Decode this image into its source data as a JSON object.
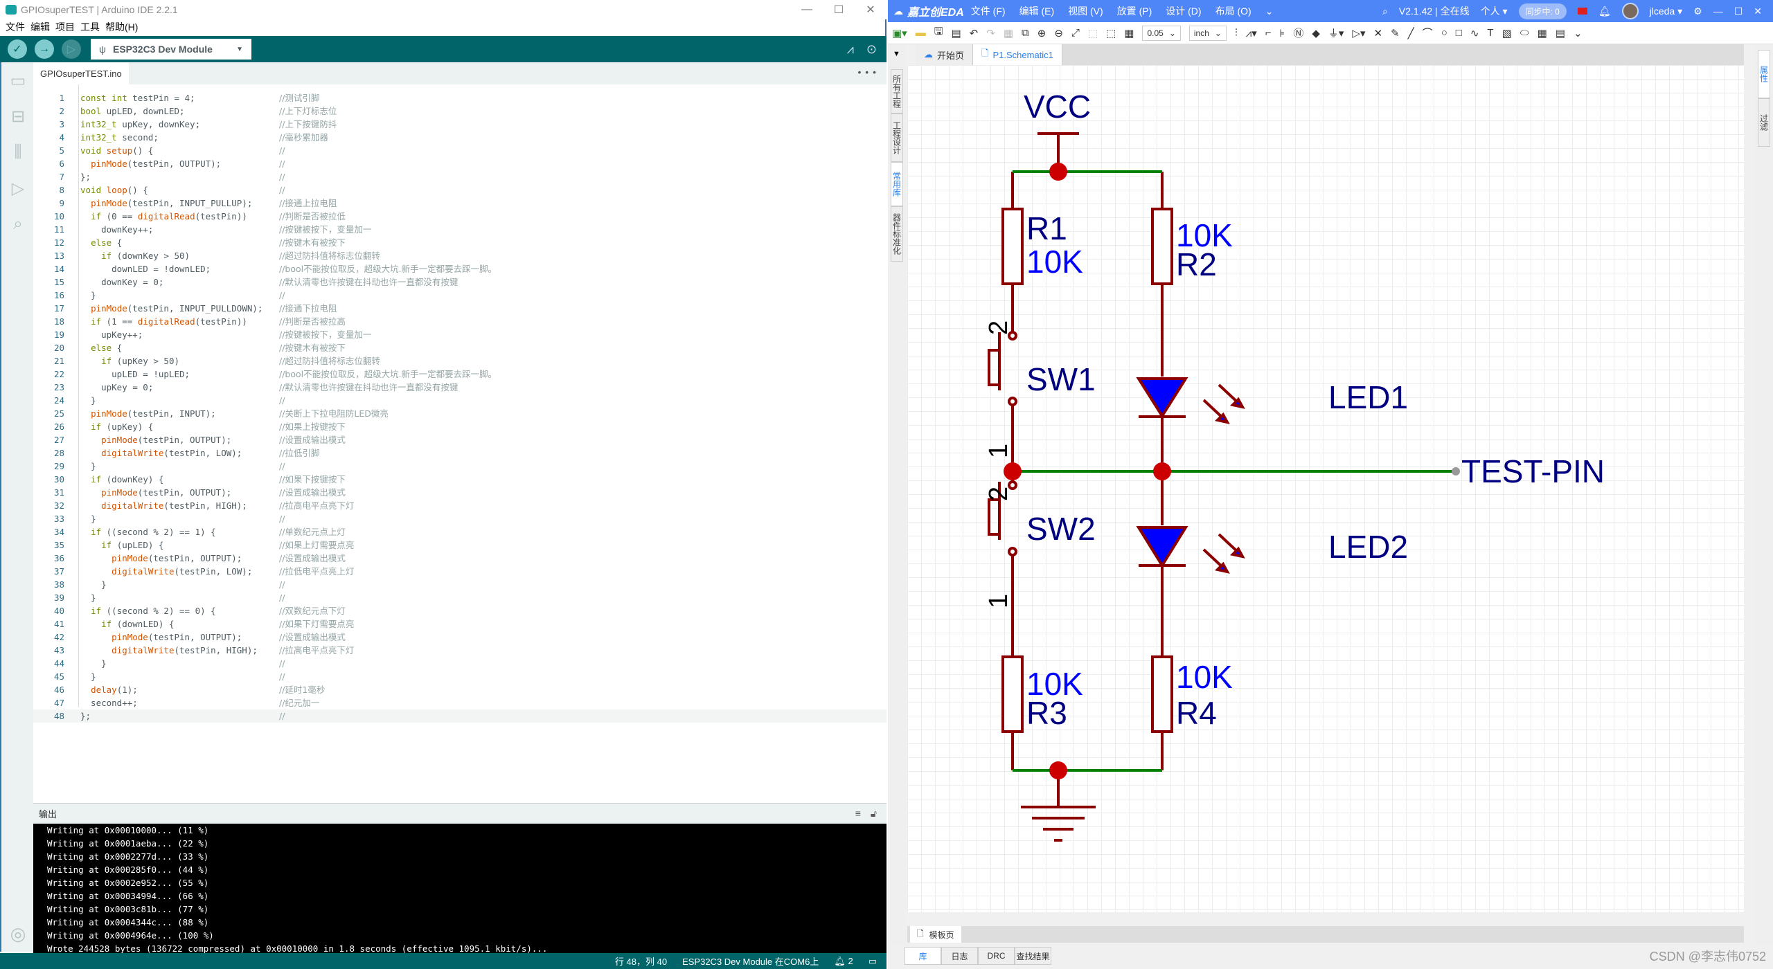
{
  "arduino": {
    "title": "GPIOsuperTEST | Arduino IDE 2.2.1",
    "menu": [
      "文件",
      "编辑",
      "项目",
      "工具",
      "帮助(H)"
    ],
    "board": "ESP32C3 Dev Module",
    "file_tab": "GPIOsuperTEST.ino",
    "code": [
      {
        "n": "1",
        "code": "const int testPin = 4;",
        "cmt": "//测试引脚"
      },
      {
        "n": "2",
        "code": "bool upLED, downLED;",
        "cmt": "//上下灯标志位"
      },
      {
        "n": "3",
        "code": "int32_t upKey, downKey;",
        "cmt": "//上下按键防抖"
      },
      {
        "n": "4",
        "code": "int32_t second;",
        "cmt": "//毫秒累加器"
      },
      {
        "n": "5",
        "code": "void setup() {",
        "cmt": "//"
      },
      {
        "n": "6",
        "code": "  pinMode(testPin, OUTPUT);",
        "cmt": "//"
      },
      {
        "n": "7",
        "code": "};",
        "cmt": "//"
      },
      {
        "n": "8",
        "code": "void loop() {",
        "cmt": "//"
      },
      {
        "n": "9",
        "code": "  pinMode(testPin, INPUT_PULLUP);",
        "cmt": "//接通上拉电阻"
      },
      {
        "n": "10",
        "code": "  if (0 == digitalRead(testPin))",
        "cmt": "//判断是否被拉低"
      },
      {
        "n": "11",
        "code": "    downKey++;",
        "cmt": "//按键被按下，变量加一"
      },
      {
        "n": "12",
        "code": "  else {",
        "cmt": "//按键木有被按下"
      },
      {
        "n": "13",
        "code": "    if (downKey > 50)",
        "cmt": "//超过防抖值将标志位翻转"
      },
      {
        "n": "14",
        "code": "      downLED = !downLED;",
        "cmt": "//bool不能按位取反，超级大坑.新手一定都要去踩一脚。"
      },
      {
        "n": "15",
        "code": "    downKey = 0;",
        "cmt": "//默认清零也许按键在抖动也许一直都没有按键"
      },
      {
        "n": "16",
        "code": "  }",
        "cmt": "//"
      },
      {
        "n": "17",
        "code": "  pinMode(testPin, INPUT_PULLDOWN);",
        "cmt": "//接通下拉电阻"
      },
      {
        "n": "18",
        "code": "  if (1 == digitalRead(testPin))",
        "cmt": "//判断是否被拉高"
      },
      {
        "n": "19",
        "code": "    upKey++;",
        "cmt": "//按键被按下，变量加一"
      },
      {
        "n": "20",
        "code": "  else {",
        "cmt": "//按键木有被按下"
      },
      {
        "n": "21",
        "code": "    if (upKey > 50)",
        "cmt": "//超过防抖值将标志位翻转"
      },
      {
        "n": "22",
        "code": "      upLED = !upLED;",
        "cmt": "//bool不能按位取反，超级大坑.新手一定都要去踩一脚。"
      },
      {
        "n": "23",
        "code": "    upKey = 0;",
        "cmt": "//默认清零也许按键在抖动也许一直都没有按键"
      },
      {
        "n": "24",
        "code": "  }",
        "cmt": "//"
      },
      {
        "n": "25",
        "code": "  pinMode(testPin, INPUT);",
        "cmt": "//关断上下拉电阻防LED微亮"
      },
      {
        "n": "26",
        "code": "  if (upKey) {",
        "cmt": "//如果上按键按下"
      },
      {
        "n": "27",
        "code": "    pinMode(testPin, OUTPUT);",
        "cmt": "//设置成输出模式"
      },
      {
        "n": "28",
        "code": "    digitalWrite(testPin, LOW);",
        "cmt": "//拉低引脚"
      },
      {
        "n": "29",
        "code": "  }",
        "cmt": "//"
      },
      {
        "n": "30",
        "code": "  if (downKey) {",
        "cmt": "//如果下按键按下"
      },
      {
        "n": "31",
        "code": "    pinMode(testPin, OUTPUT);",
        "cmt": "//设置成输出模式"
      },
      {
        "n": "32",
        "code": "    digitalWrite(testPin, HIGH);",
        "cmt": "//拉高电平点亮下灯"
      },
      {
        "n": "33",
        "code": "  }",
        "cmt": "//"
      },
      {
        "n": "34",
        "code": "  if ((second % 2) == 1) {",
        "cmt": "//单数纪元点上灯"
      },
      {
        "n": "35",
        "code": "    if (upLED) {",
        "cmt": "//如果上灯需要点亮"
      },
      {
        "n": "36",
        "code": "      pinMode(testPin, OUTPUT);",
        "cmt": "//设置成输出模式"
      },
      {
        "n": "37",
        "code": "      digitalWrite(testPin, LOW);",
        "cmt": "//拉低电平点亮上灯"
      },
      {
        "n": "38",
        "code": "    }",
        "cmt": "//"
      },
      {
        "n": "39",
        "code": "  }",
        "cmt": "//"
      },
      {
        "n": "40",
        "code": "  if ((second % 2) == 0) {",
        "cmt": "//双数纪元点下灯"
      },
      {
        "n": "41",
        "code": "    if (downLED) {",
        "cmt": "//如果下灯需要点亮"
      },
      {
        "n": "42",
        "code": "      pinMode(testPin, OUTPUT);",
        "cmt": "//设置成输出模式"
      },
      {
        "n": "43",
        "code": "      digitalWrite(testPin, HIGH);",
        "cmt": "//拉高电平点亮下灯"
      },
      {
        "n": "44",
        "code": "    }",
        "cmt": "//"
      },
      {
        "n": "45",
        "code": "  }",
        "cmt": "//"
      },
      {
        "n": "46",
        "code": "  delay(1);",
        "cmt": "//延时1毫秒"
      },
      {
        "n": "47",
        "code": "  second++;",
        "cmt": "//纪元加一"
      },
      {
        "n": "48",
        "code": "};",
        "cmt": "//"
      }
    ],
    "output_label": "输出",
    "console": [
      "Writing at 0x00010000... (11 %)",
      "Writing at 0x0001aeba... (22 %)",
      "Writing at 0x0002277d... (33 %)",
      "Writing at 0x000285f0... (44 %)",
      "Writing at 0x0002e952... (55 %)",
      "Writing at 0x00034994... (66 %)",
      "Writing at 0x0003c81b... (77 %)",
      "Writing at 0x0004344c... (88 %)",
      "Writing at 0x0004964e... (100 %)",
      "Wrote 244528 bytes (136722 compressed) at 0x00010000 in 1.8 seconds (effective 1095.1 kbit/s)..."
    ],
    "status": {
      "position": "行 48，列 40",
      "board_port": "ESP32C3 Dev Module 在COM6上",
      "notifications": "2"
    }
  },
  "eda": {
    "brand": "嘉立创EDA",
    "menu": [
      "文件 (F)",
      "编辑 (E)",
      "视图 (V)",
      "放置 (P)",
      "设计 (D)",
      "布局 (O)"
    ],
    "version": "V2.1.42 | 全在线",
    "workspace": "个人",
    "sync": "同步中: 0",
    "user": "jlceda",
    "grid": "0.05",
    "unit": "inch",
    "doc_tabs": [
      "开始页",
      "P1.Schematic1"
    ],
    "left_tabs": [
      "所有工程",
      "工程设计",
      "常用库",
      "器件标准化"
    ],
    "right_tabs": [
      "属性",
      "过滤"
    ],
    "sheet_tab": "模板页",
    "bottom_tabs": [
      "库",
      "日志",
      "DRC",
      "查找结果"
    ],
    "schematic": {
      "power": "VCC",
      "net": "TEST-PIN",
      "r1": {
        "ref": "R1",
        "val": "10K"
      },
      "r2": {
        "ref": "R2",
        "val": "10K"
      },
      "r3": {
        "ref": "R3",
        "val": "10K"
      },
      "r4": {
        "ref": "R4",
        "val": "10K"
      },
      "sw1": {
        "ref": "SW1",
        "pin_top": "2",
        "pin_bot": "1"
      },
      "sw2": {
        "ref": "SW2",
        "pin_top": "2",
        "pin_bot": "1"
      },
      "led1": "LED1",
      "led2": "LED2"
    }
  },
  "watermark": "CSDN @李志伟0752"
}
